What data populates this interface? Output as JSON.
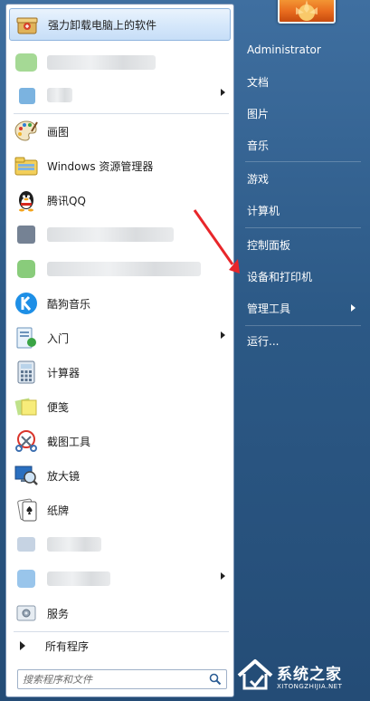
{
  "left_panel": {
    "pinned_item": "强力卸载电脑上的软件",
    "items": [
      "画图",
      "Windows 资源管理器",
      "腾讯QQ",
      "酷狗音乐",
      "入门",
      "计算器",
      "便笺",
      "截图工具",
      "放大镜",
      "纸牌",
      "服务"
    ],
    "all_programs": "所有程序",
    "search_placeholder": "搜索程序和文件"
  },
  "right_panel": {
    "items": [
      "Administrator",
      "文档",
      "图片",
      "音乐",
      "游戏",
      "计算机",
      "控制面板",
      "设备和打印机",
      "管理工具",
      "运行..."
    ]
  },
  "watermark": {
    "text": "系统之家",
    "subtext": "XITONGZHIJIA.NET"
  },
  "colors": {
    "taskbar_blue": "#2c5986",
    "annotation_arrow": "#e8262a"
  }
}
